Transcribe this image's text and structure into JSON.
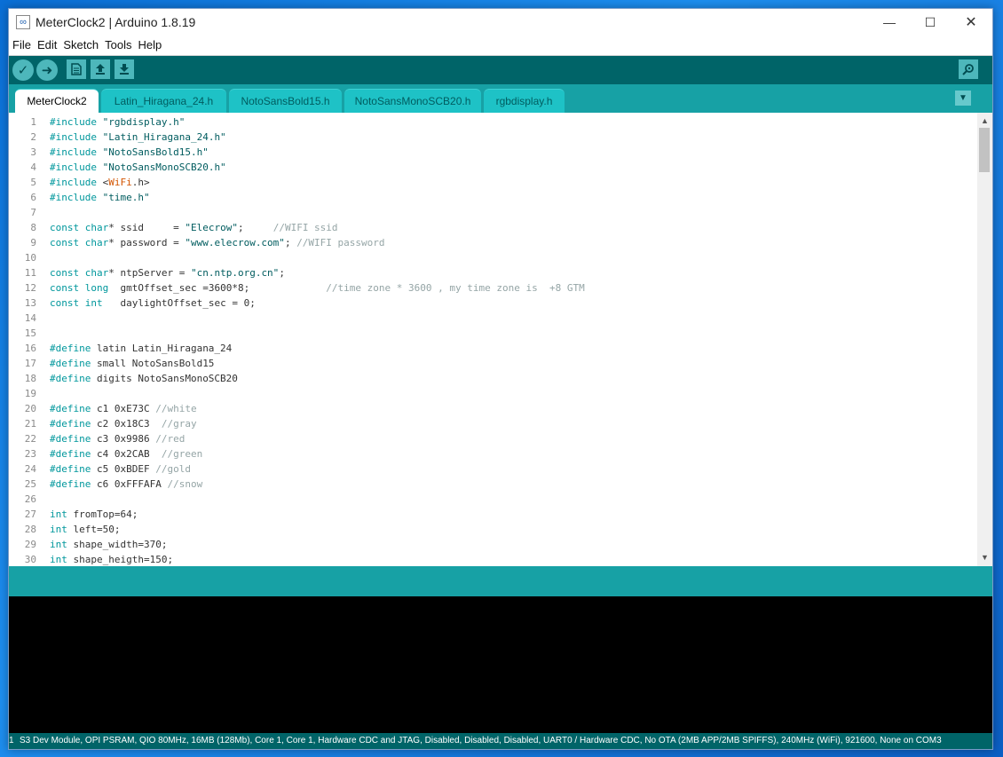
{
  "window": {
    "title": "MeterClock2 | Arduino 1.8.19"
  },
  "menu": [
    "File",
    "Edit",
    "Sketch",
    "Tools",
    "Help"
  ],
  "tabs": [
    "MeterClock2",
    "Latin_Hiragana_24.h",
    "NotoSansBold15.h",
    "NotoSansMonoSCB20.h",
    "rgbdisplay.h"
  ],
  "active_tab": "MeterClock2",
  "code_lines": [
    {
      "n": "1",
      "html": "<span class='kw'>#include</span> <span class='str'>\"rgbdisplay.h\"</span>"
    },
    {
      "n": "2",
      "html": "<span class='kw'>#include</span> <span class='str'>\"Latin_Hiragana_24.h\"</span>"
    },
    {
      "n": "3",
      "html": "<span class='kw'>#include</span> <span class='str'>\"NotoSansBold15.h\"</span>"
    },
    {
      "n": "4",
      "html": "<span class='kw'>#include</span> <span class='str'>\"NotoSansMonoSCB20.h\"</span>"
    },
    {
      "n": "5",
      "html": "<span class='kw'>#include</span> &lt;<span class='lib'>WiFi</span>.h&gt;"
    },
    {
      "n": "6",
      "html": "<span class='kw'>#include</span> <span class='str'>\"time.h\"</span>"
    },
    {
      "n": "7",
      "html": ""
    },
    {
      "n": "8",
      "html": "<span class='kw'>const</span> <span class='kw'>char</span>* ssid     = <span class='str'>\"Elecrow\"</span>;     <span class='cmt'>//WIFI ssid</span>"
    },
    {
      "n": "9",
      "html": "<span class='kw'>const</span> <span class='kw'>char</span>* password = <span class='str'>\"www.elecrow.com\"</span>; <span class='cmt'>//WIFI password</span>"
    },
    {
      "n": "10",
      "html": ""
    },
    {
      "n": "11",
      "html": "<span class='kw'>const</span> <span class='kw'>char</span>* ntpServer = <span class='str'>\"cn.ntp.org.cn\"</span>;"
    },
    {
      "n": "12",
      "html": "<span class='kw'>const</span> <span class='kw'>long</span>  gmtOffset_sec =3600*8;             <span class='cmt'>//time zone * 3600 , my time zone is  +8 GTM</span>"
    },
    {
      "n": "13",
      "html": "<span class='kw'>const</span> <span class='kw'>int</span>   daylightOffset_sec = 0;"
    },
    {
      "n": "14",
      "html": ""
    },
    {
      "n": "15",
      "html": ""
    },
    {
      "n": "16",
      "html": "<span class='kw'>#define</span> latin Latin_Hiragana_24"
    },
    {
      "n": "17",
      "html": "<span class='kw'>#define</span> small NotoSansBold15"
    },
    {
      "n": "18",
      "html": "<span class='kw'>#define</span> digits NotoSansMonoSCB20"
    },
    {
      "n": "19",
      "html": ""
    },
    {
      "n": "20",
      "html": "<span class='kw'>#define</span> c1 0xE73C <span class='cmt'>//white</span>"
    },
    {
      "n": "21",
      "html": "<span class='kw'>#define</span> c2 0x18C3  <span class='cmt'>//gray</span>"
    },
    {
      "n": "22",
      "html": "<span class='kw'>#define</span> c3 0x9986 <span class='cmt'>//red</span>"
    },
    {
      "n": "23",
      "html": "<span class='kw'>#define</span> c4 0x2CAB  <span class='cmt'>//green</span>"
    },
    {
      "n": "24",
      "html": "<span class='kw'>#define</span> c5 0xBDEF <span class='cmt'>//gold</span>"
    },
    {
      "n": "25",
      "html": "<span class='kw'>#define</span> c6 0xFFFAFA <span class='cmt'>//snow</span>"
    },
    {
      "n": "26",
      "html": ""
    },
    {
      "n": "27",
      "html": "<span class='kw'>int</span> fromTop=64;"
    },
    {
      "n": "28",
      "html": "<span class='kw'>int</span> left=50;"
    },
    {
      "n": "29",
      "html": "<span class='kw'>int</span> shape_width=370;"
    },
    {
      "n": "30",
      "html": "<span class='kw'>int</span> shape_heigth=150;"
    }
  ],
  "status": {
    "line_number": "1",
    "board": "S3 Dev Module, OPI PSRAM, QIO 80MHz, 16MB (128Mb), Core 1, Core 1, Hardware CDC and JTAG, Disabled, Disabled, Disabled, UART0 / Hardware CDC, No OTA (2MB APP/2MB SPIFFS), 240MHz (WiFi), 921600, None on COM3"
  },
  "colors": {
    "toolbar": "#006468",
    "tabbar": "#17a1a5",
    "keyword": "#00979c",
    "library": "#d35400",
    "comment": "#95a5a6"
  },
  "icons": {
    "verify": "check-icon",
    "upload": "arrow-right-icon",
    "new": "page-icon",
    "open": "arrow-up-icon",
    "save": "arrow-down-icon",
    "serial_monitor": "magnifier-icon"
  }
}
